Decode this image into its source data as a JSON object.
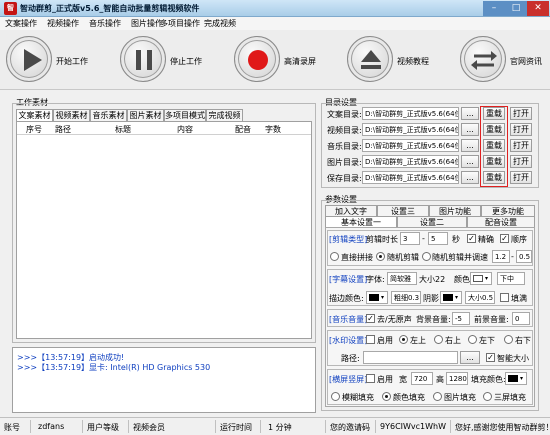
{
  "window": {
    "title": "智动群剪_正式版v5.6_智能自动批量剪辑视频软件",
    "icon_text": "智"
  },
  "menu": [
    "文案操作",
    "视频操作",
    "音乐操作",
    "图片操作",
    "多项目操作",
    "完成视频"
  ],
  "toolbar": {
    "start": "开始工作",
    "stop": "停止工作",
    "record": "高清录屏",
    "tutorial": "视频教程",
    "news": "官网资讯"
  },
  "work": {
    "group_title": "工作素材",
    "tabs": [
      "文案素材",
      "视频素材",
      "音乐素材",
      "图片素材",
      "多项目模式",
      "完成视频"
    ],
    "columns": [
      "序号",
      "路径",
      "标题",
      "内容",
      "配音",
      "字数"
    ]
  },
  "log": {
    "lines": [
      {
        "prefix": ">>>",
        "time": "【13:57:19】",
        "text": "启动成功!"
      },
      {
        "prefix": ">>>",
        "time": "【13:57:19】",
        "text": "显卡: Intel(R) HD Graphics 530"
      }
    ]
  },
  "dirs": {
    "group_title": "目录设置",
    "rows": [
      {
        "label": "文案目录:",
        "path": "D:\\智动群剪_正式版v5.6(64位系统)"
      },
      {
        "label": "视频目录:",
        "path": "D:\\智动群剪_正式版v5.6(64位系统)"
      },
      {
        "label": "音乐目录:",
        "path": "D:\\智动群剪_正式版v5.6(64位系统)"
      },
      {
        "label": "图片目录:",
        "path": "D:\\智动群剪_正式版v5.6(64位系统)"
      },
      {
        "label": "保存目录:",
        "path": "D:\\智动群剪_正式版v5.6(64位系统)"
      }
    ],
    "browse": "...",
    "reload": "重载",
    "open": "打开",
    "highlight_color": "#e02020"
  },
  "params": {
    "group_title": "参数设置",
    "tabs_row1": [
      "加入文字",
      "设置三",
      "图片功能",
      "更多功能"
    ],
    "tabs_row2": [
      "基本设置一",
      "设置二",
      "配音设置"
    ],
    "clip": {
      "title": "[剪辑类型]",
      "duration_label": "剪辑时长",
      "duration_min": "3",
      "duration_max": "5",
      "sec": "秒",
      "exact": "精确",
      "order": "顺序",
      "opt1": "直接拼接",
      "opt2": "随机剪辑",
      "opt3": "随机剪辑并调速",
      "speed_min": "1.2",
      "speed_max": "0.5"
    },
    "subtitle": {
      "title": "[字幕设置]",
      "font_label": "字体:",
      "font": "简软雅",
      "size": "大小22",
      "color_label": "颜色",
      "position": "下中",
      "stroke_label": "描边颜色:",
      "thickness": "粗细0.3",
      "shadow": "阴影",
      "size2": "大小0.5",
      "fill": "填满"
    },
    "music": {
      "title": "[音乐音量]",
      "mute": "去/无原声",
      "bg_label": "背景音量:",
      "bg_value": "-5",
      "fg_label": "前景音量:",
      "fg_value": "0"
    },
    "watermark": {
      "title": "[水印设置]",
      "enable": "启用",
      "pos": [
        "左上",
        "右上",
        "左下",
        "右下"
      ],
      "path_label": "路径:",
      "browse": "...",
      "smart": "智能大小"
    },
    "landscape": {
      "title": "[横屏竖屏]",
      "enable": "启用",
      "width_label": "宽",
      "width": "720",
      "height_label": "高",
      "height": "1280",
      "fill_color_label": "填充颜色:",
      "modes": [
        "模糊填充",
        "颜色填充",
        "图片填充",
        "三屏填充"
      ]
    }
  },
  "status": {
    "account_label": "账号",
    "account": "zdfans",
    "level_label": "用户等级",
    "level": "视频会员",
    "runtime_label": "运行时间",
    "runtime": "1 分钟",
    "code_label": "您的邀请码",
    "code": "9Y6CIWvc1WhW",
    "thanks": "您好,感谢您使用智动群剪！"
  }
}
